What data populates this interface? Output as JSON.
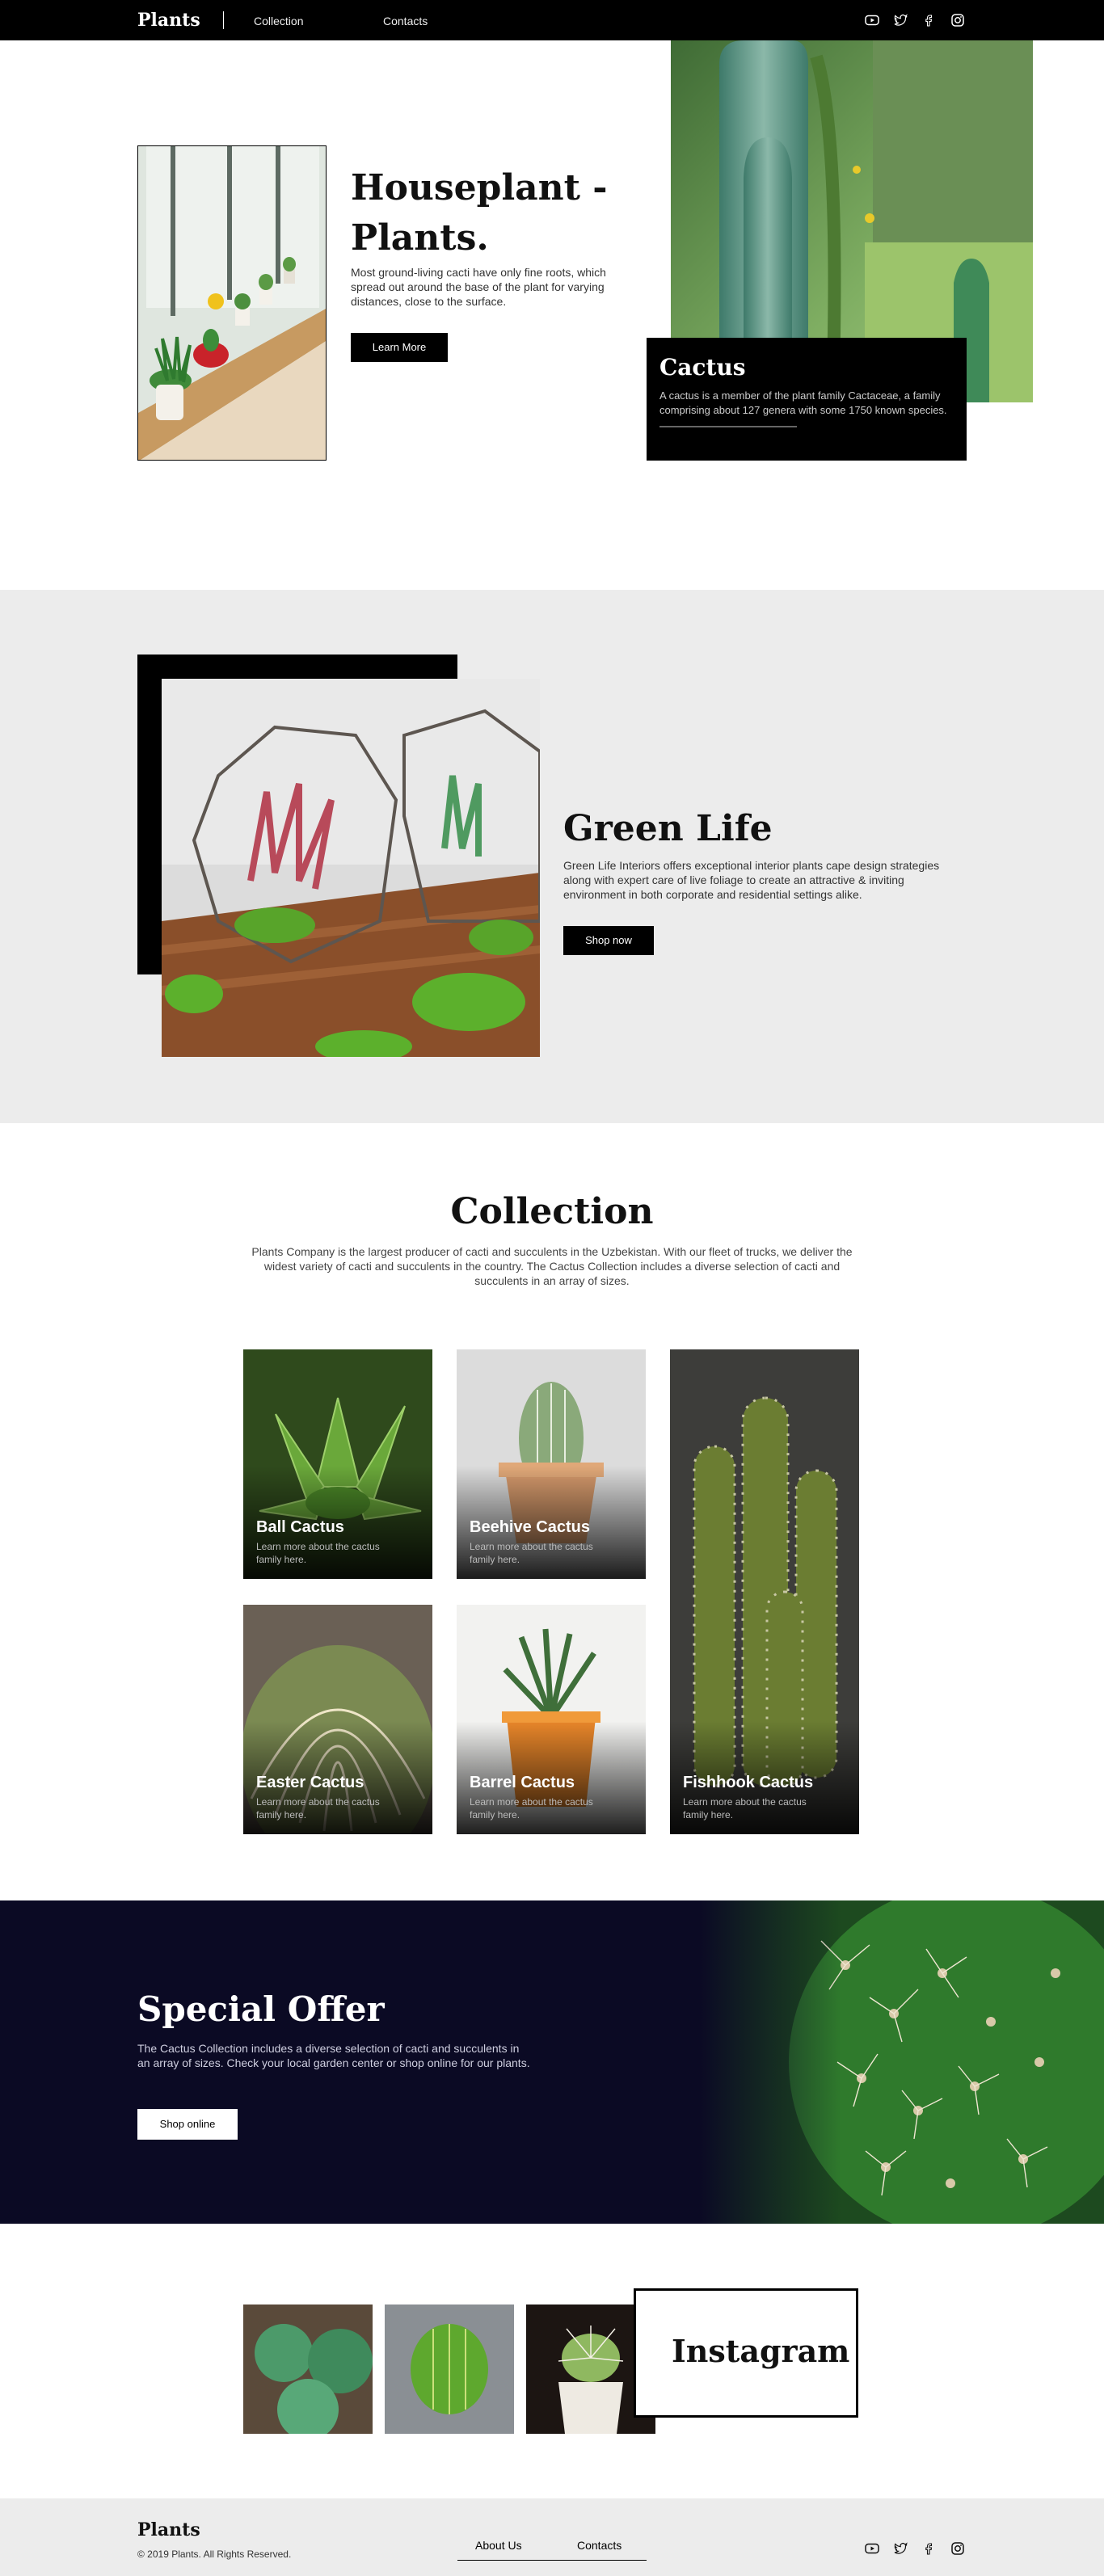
{
  "header": {
    "logo": "Plants",
    "nav": [
      "Collection",
      "Contacts"
    ],
    "social_icons": [
      "youtube-icon",
      "twitter-icon",
      "facebook-icon",
      "instagram-icon"
    ]
  },
  "hero": {
    "title": "Houseplant - Plants.",
    "description": "Most ground-living cacti have only fine roots, which spread out around the base of the plant for varying distances, close to the surface.",
    "button_label": "Learn More",
    "card": {
      "title": "Cactus",
      "text": "A cactus is a member of the plant family Cactaceae, a family comprising about 127 genera with some 1750 known species."
    }
  },
  "green_life": {
    "title": "Green Life",
    "description": "Green Life Interiors offers exceptional interior plants cape design strategies along with expert care of live foliage to create an attractive & inviting environment in both corporate and residential settings alike.",
    "button_label": "Shop now"
  },
  "collection": {
    "title": "Collection",
    "description": "Plants Company is the largest producer of cacti and succulents in the Uzbekistan. With our fleet of trucks, we deliver the widest variety of cacti and succulents in the country. The Cactus Collection includes a diverse selection of cacti and succulents in an array of sizes.",
    "items": [
      {
        "name": "Ball Cactus",
        "sub": "Learn more about the cactus family here."
      },
      {
        "name": "Beehive Cactus",
        "sub": "Learn more about the cactus family here."
      },
      {
        "name": "Fishhook Cactus",
        "sub": "Learn more about the cactus family here."
      },
      {
        "name": "Easter Cactus",
        "sub": "Learn more about the cactus family here."
      },
      {
        "name": "Barrel Cactus",
        "sub": "Learn more about the cactus family here."
      }
    ]
  },
  "offer": {
    "title": "Special Offer",
    "description": "The Cactus Collection includes a diverse selection of cacti and succulents in an array of sizes. Check your local garden center or shop online for our plants.",
    "button_label": "Shop online"
  },
  "instagram": {
    "title": "Instagram"
  },
  "footer": {
    "logo": "Plants",
    "copyright": "© 2019 Plants. All Rights Reserved.",
    "nav": [
      "About Us",
      "Contacts"
    ],
    "social_icons": [
      "youtube-icon",
      "twitter-icon",
      "facebook-icon",
      "instagram-icon"
    ]
  },
  "colors": {
    "black": "#000000",
    "section_gray": "#ececec",
    "offer_navy": "#0b0a24",
    "cactus_green": "#5a8a3c"
  }
}
